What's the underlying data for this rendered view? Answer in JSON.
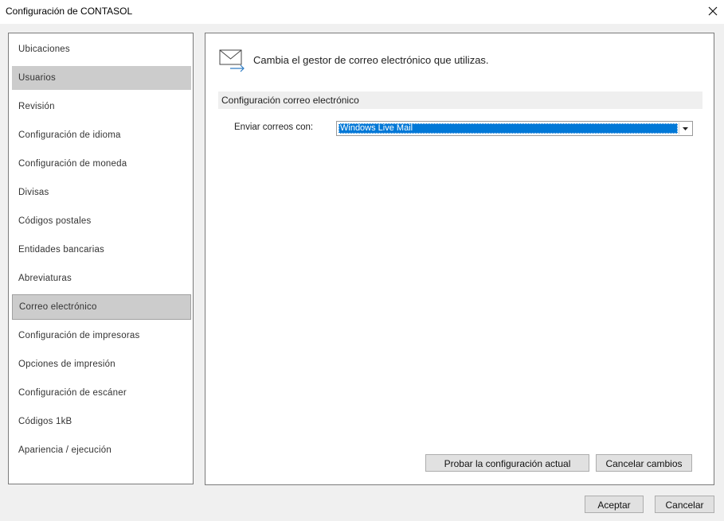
{
  "window": {
    "title": "Configuración de CONTASOL"
  },
  "sidebar": {
    "items": [
      {
        "label": "Ubicaciones"
      },
      {
        "label": "Usuarios"
      },
      {
        "label": "Revisión"
      },
      {
        "label": "Configuración de idioma"
      },
      {
        "label": "Configuración de moneda"
      },
      {
        "label": "Divisas"
      },
      {
        "label": "Códigos postales"
      },
      {
        "label": "Entidades bancarias"
      },
      {
        "label": "Abreviaturas"
      },
      {
        "label": "Correo electrónico"
      },
      {
        "label": "Configuración de impresoras"
      },
      {
        "label": "Opciones de impresión"
      },
      {
        "label": "Configuración de escáner"
      },
      {
        "label": "Códigos 1kB"
      },
      {
        "label": "Apariencia / ejecución"
      }
    ]
  },
  "main": {
    "header": "Cambia el gestor de correo electrónico que utilizas.",
    "section_title": "Configuración correo electrónico",
    "send_with_label": "Enviar correos con:",
    "send_with_value": "Windows Live Mail",
    "test_button": "Probar la configuración actual",
    "cancel_changes_button": "Cancelar cambios"
  },
  "footer": {
    "accept_button": "Aceptar",
    "cancel_button": "Cancelar"
  },
  "colors": {
    "accent": "#0078d7",
    "selected_bg": "#cccccc"
  }
}
